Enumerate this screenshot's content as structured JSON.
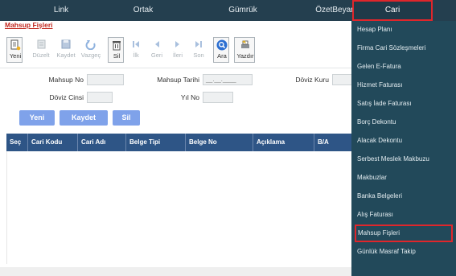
{
  "topnav": {
    "items": [
      {
        "label": "Link"
      },
      {
        "label": "Ortak"
      },
      {
        "label": "Gümrük"
      },
      {
        "label": "ÖzetBeyan"
      },
      {
        "label": "Cari"
      }
    ]
  },
  "page": {
    "title": "Mahsup Fişleri"
  },
  "toolbar": {
    "yeni": "Yeni",
    "duzelt": "Düzelt",
    "kaydet": "Kaydet",
    "vazgec": "Vazgeç",
    "sil": "Sil",
    "ilk": "İlk",
    "geri": "Geri",
    "ileri": "İleri",
    "son": "Son",
    "ara": "Ara",
    "yazdir": "Yazdır"
  },
  "form": {
    "mahsup_no_label": "Mahsup No",
    "mahsup_no_value": "",
    "mahsup_tarihi_label": "Mahsup Tarihi",
    "mahsup_tarihi_value": "__.__.____",
    "doviz_kuru_label": "Döviz Kuru",
    "doviz_kuru_value": "",
    "doviz_cinsi_label": "Döviz Cinsi",
    "doviz_cinsi_value": "",
    "yil_no_label": "Yıl No",
    "yil_no_value": ""
  },
  "actions": {
    "yeni": "Yeni",
    "kaydet": "Kaydet",
    "sil": "Sil"
  },
  "table": {
    "columns": [
      "Seç",
      "Cari Kodu",
      "Cari Adı",
      "Belge Tipi",
      "Belge No",
      "Açıklama",
      "B/A"
    ]
  },
  "menu": {
    "items": [
      {
        "label": "Hesap Planı"
      },
      {
        "label": "Firma Cari Sözleşmeleri"
      },
      {
        "label": "Gelen E-Fatura"
      },
      {
        "label": "Hizmet Faturası"
      },
      {
        "label": "Satış İade Faturası"
      },
      {
        "label": "Borç Dekontu"
      },
      {
        "label": "Alacak Dekontu"
      },
      {
        "label": "Serbest Meslek Makbuzu"
      },
      {
        "label": "Makbuzlar"
      },
      {
        "label": "Banka Belgeleri"
      },
      {
        "label": "Alış Faturası"
      },
      {
        "label": "Mahsup Fişleri"
      },
      {
        "label": "Günlük Masraf Takip"
      }
    ]
  },
  "colors": {
    "topbar": "#243f4f",
    "menu": "#22495a",
    "highlight": "#e0262b",
    "table_header": "#2e5586",
    "button": "#7fa2ea",
    "title": "#c2281f"
  }
}
